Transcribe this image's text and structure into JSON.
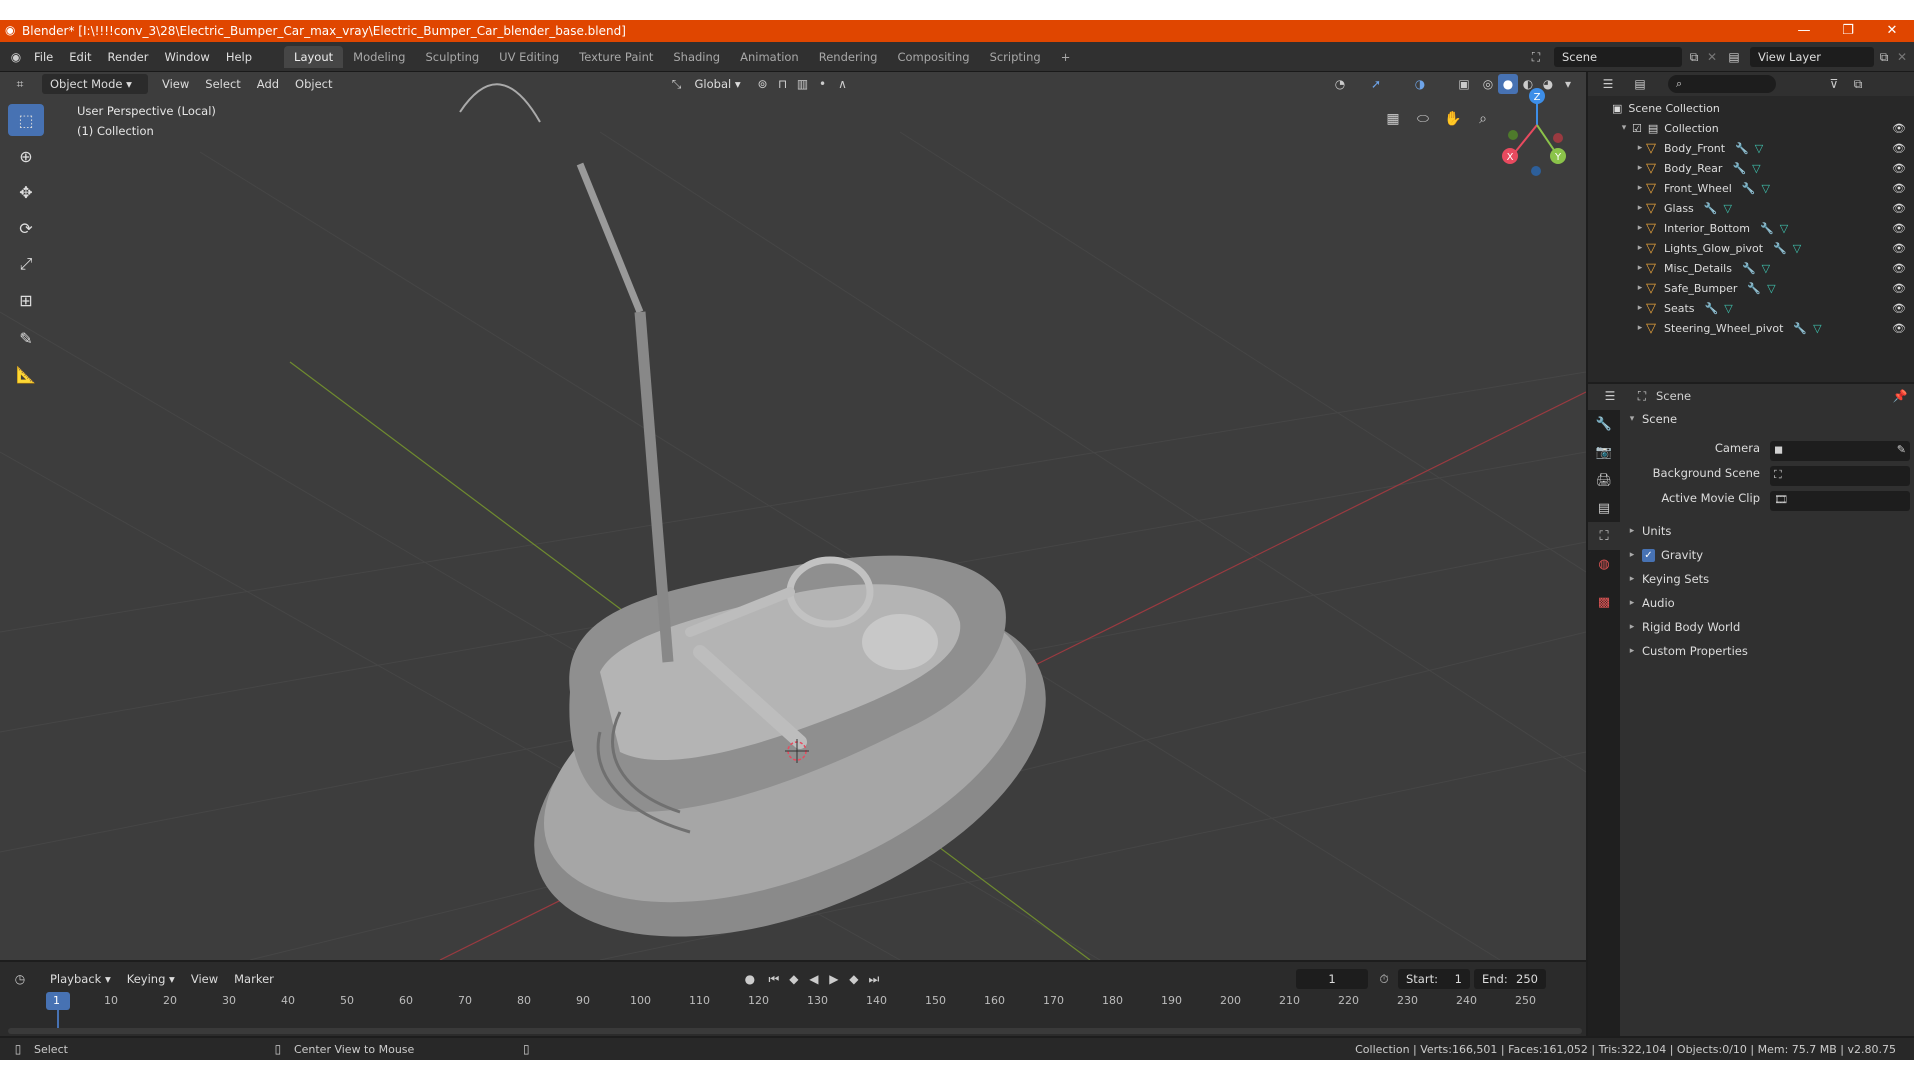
{
  "window": {
    "title": "Blender* [I:\\!!!!conv_3\\28\\Electric_Bumper_Car_max_vray\\Electric_Bumper_Car_blender_base.blend]",
    "controls": [
      "—",
      "❐",
      "✕"
    ]
  },
  "menubar": {
    "menus": [
      "File",
      "Edit",
      "Render",
      "Window",
      "Help"
    ],
    "workspaces": [
      "Layout",
      "Modeling",
      "Sculpting",
      "UV Editing",
      "Texture Paint",
      "Shading",
      "Animation",
      "Rendering",
      "Compositing",
      "Scripting"
    ],
    "active_workspace": "Layout",
    "add_tab": "+",
    "scene": "Scene",
    "view_layer": "View Layer"
  },
  "viewport_header": {
    "mode": "Object Mode",
    "menus": [
      "View",
      "Select",
      "Add",
      "Object"
    ],
    "orientation": "Global"
  },
  "viewport": {
    "perspective": "User Perspective (Local)",
    "collection": "(1) Collection",
    "gizmo_axes": [
      "X",
      "Y",
      "Z"
    ]
  },
  "outliner": {
    "root": "Scene Collection",
    "collection": "Collection",
    "objects": [
      "Body_Front",
      "Body_Rear",
      "Front_Wheel",
      "Glass",
      "Interior_Bottom",
      "Lights_Glow_pivot",
      "Misc_Details",
      "Safe_Bumper",
      "Seats",
      "Steering_Wheel_pivot"
    ]
  },
  "properties": {
    "context": "Scene",
    "panel": "Scene",
    "fields": [
      {
        "label": "Camera"
      },
      {
        "label": "Background Scene"
      },
      {
        "label": "Active Movie Clip"
      }
    ],
    "subpanels": [
      "Units",
      "Gravity",
      "Keying Sets",
      "Audio",
      "Rigid Body World",
      "Custom Properties"
    ],
    "gravity_checked": true
  },
  "timeline": {
    "menus": [
      "Playback",
      "Keying",
      "View",
      "Marker"
    ],
    "current_frame": "1",
    "start_label": "Start:",
    "start": "1",
    "end_label": "End:",
    "end": "250",
    "ticks": [
      "1",
      "10",
      "20",
      "30",
      "40",
      "50",
      "60",
      "70",
      "80",
      "90",
      "100",
      "110",
      "120",
      "130",
      "140",
      "150",
      "160",
      "170",
      "180",
      "190",
      "200",
      "210",
      "220",
      "230",
      "240",
      "250"
    ]
  },
  "statusbar": {
    "select": "Select",
    "center": "Center View to Mouse",
    "stats": "Collection | Verts:166,501 | Faces:161,052 | Tris:322,104 | Objects:0/10 | Mem: 75.7 MB | v2.80.75"
  },
  "colors": {
    "title_bar": "#e04600",
    "accent": "#4772b3",
    "viewport_bg": "#3d3d3d",
    "mesh_icon": "#e8a33c",
    "x_axis": "#e84a5f",
    "y_axis": "#8bc34a",
    "z_axis": "#3d8ee8"
  }
}
